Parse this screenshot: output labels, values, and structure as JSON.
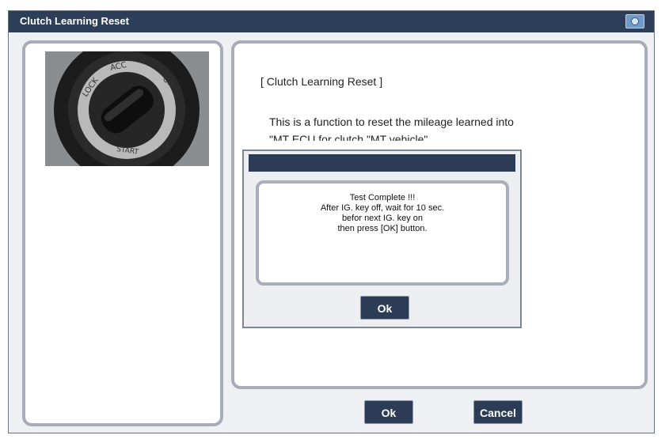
{
  "window": {
    "title": "Clutch Learning Reset"
  },
  "content": {
    "heading": "[ Clutch Learning Reset ]",
    "description": "This is a function to reset the  mileage learned into",
    "description_cont": "\"MT ECU for clutch \"MT vehicle\"."
  },
  "dialog": {
    "lines": [
      "Test Complete !!!",
      "After IG. key off, wait for 10 sec.",
      "befor next IG. key on",
      "then press [OK] button."
    ],
    "ok_label": "Ok"
  },
  "footer": {
    "ok_label": "Ok",
    "cancel_label": "Cancel"
  },
  "photo": {
    "key_labels": [
      "LOCK",
      "ACC",
      "ON",
      "START"
    ]
  },
  "colors": {
    "titlebar": "#2d3e5a",
    "button": "#2c3b56",
    "panel_border": "#a7acb8"
  }
}
